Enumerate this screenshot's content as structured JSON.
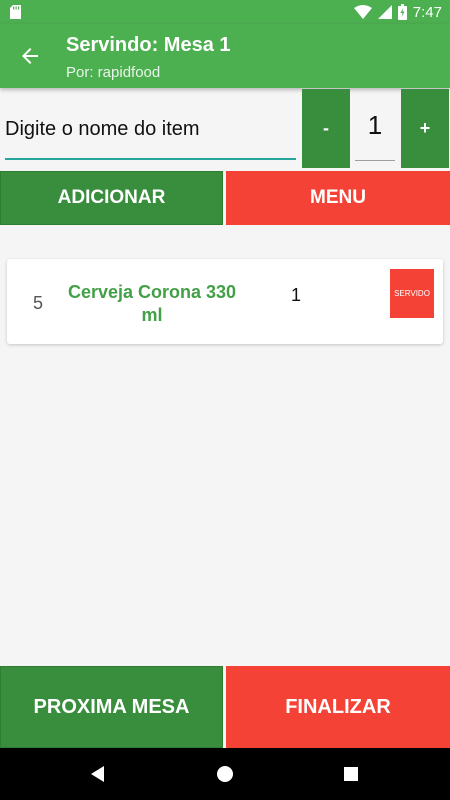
{
  "status_bar": {
    "time": "7:47",
    "icons": [
      "sd-card-icon",
      "wifi-icon",
      "signal-icon",
      "battery-icon"
    ]
  },
  "app_bar": {
    "title": "Servindo: Mesa 1",
    "subtitle": "Por: rapidfood",
    "back_icon": "arrow-back-icon"
  },
  "item_entry": {
    "placeholder": "Digite o nome do item",
    "value": "",
    "minus_label": "-",
    "plus_label": "+",
    "quantity": "1"
  },
  "actions": {
    "add_label": "ADICIONAR",
    "menu_label": "MENU"
  },
  "items": [
    {
      "number": "5",
      "name": "Cerveja Corona 330 ml",
      "quantity": "1",
      "status_label": "SERVIDO"
    }
  ],
  "footer": {
    "next_label": "PROXIMA MESA",
    "finish_label": "FINALIZAR"
  },
  "nav_bar": {
    "icons": [
      "back-triangle-icon",
      "home-circle-icon",
      "recents-square-icon"
    ]
  },
  "colors": {
    "primary": "#4caf50",
    "primary_dark": "#388e3c",
    "danger": "#f44336",
    "item_text": "#43a047",
    "accent": "#26a69a"
  }
}
